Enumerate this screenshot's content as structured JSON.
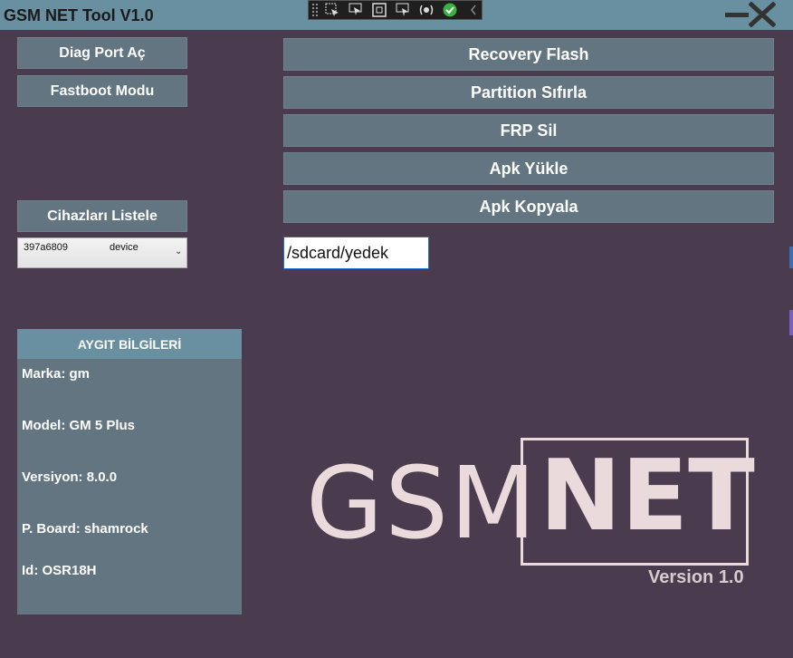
{
  "window": {
    "title": "GSM NET Tool V1.0"
  },
  "left_buttons": {
    "diag": "Diag Port Aç",
    "fastboot": "Fastboot Modu",
    "list_devices": "Cihazları Listele"
  },
  "device_combo": {
    "serial": "397a6809",
    "state": "device"
  },
  "right_buttons": {
    "recovery": "Recovery Flash",
    "partition": "Partition Sıfırla",
    "frp": "FRP Sil",
    "apk_install": "Apk Yükle",
    "apk_copy": "Apk Kopyala"
  },
  "path_input": {
    "value": "/sdcard/yedek"
  },
  "info": {
    "header": "AYGIT BİLGİLERİ",
    "brand": "Marka: gm",
    "model": "Model: GM 5 Plus",
    "version": "Versiyon: 8.0.0",
    "board": "P. Board: shamrock",
    "id": "Id: OSR18H"
  },
  "logo": {
    "left": "GSM",
    "right": "NET",
    "version": "Version 1.0"
  },
  "icons": [
    "select-element-icon",
    "pointer-icon",
    "frame-icon",
    "display-icon",
    "hot-reload-icon",
    "check-icon",
    "collapse-icon",
    "minimize-icon",
    "close-icon"
  ],
  "colors": {
    "background": "#4a3c4e",
    "titlebar": "#6990a0",
    "button": "#627580",
    "logo": "#eadadb"
  }
}
